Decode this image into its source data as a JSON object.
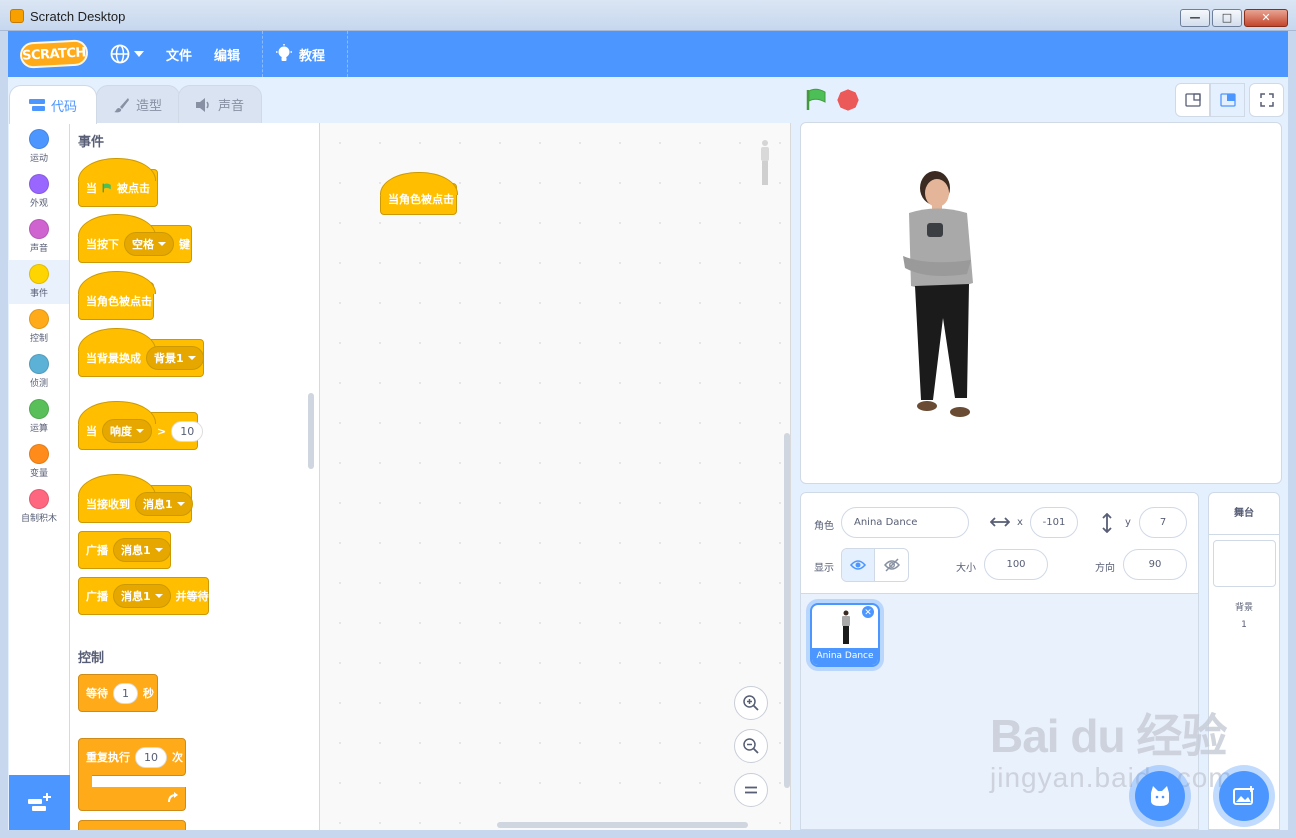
{
  "window": {
    "title": "Scratch Desktop"
  },
  "menubar": {
    "logo": "SCRATCH",
    "file": "文件",
    "edit": "编辑",
    "tutorials": "教程"
  },
  "tabs": [
    {
      "label": "代码",
      "icon": "code-icon"
    },
    {
      "label": "造型",
      "icon": "brush-icon"
    },
    {
      "label": "声音",
      "icon": "speaker-icon"
    }
  ],
  "categories": [
    {
      "label": "运动",
      "color": "#4c97ff"
    },
    {
      "label": "外观",
      "color": "#9966ff"
    },
    {
      "label": "声音",
      "color": "#cf63cf"
    },
    {
      "label": "事件",
      "color": "#ffd500"
    },
    {
      "label": "控制",
      "color": "#ffab19"
    },
    {
      "label": "侦测",
      "color": "#5cb1d6"
    },
    {
      "label": "运算",
      "color": "#59c059"
    },
    {
      "label": "变量",
      "color": "#ff8c1a"
    },
    {
      "label": "自制积木",
      "color": "#ff6680"
    }
  ],
  "palette": {
    "events_heading": "事件",
    "control_heading": "控制",
    "when_flag_pre": "当",
    "when_flag_post": "被点击",
    "when_key_pre": "当按下",
    "when_key_value": "空格",
    "when_key_post": "键",
    "when_sprite_clicked": "当角色被点击",
    "when_backdrop_pre": "当背景换成",
    "when_backdrop_value": "背景1",
    "when_loudness_pre": "当",
    "when_loudness_value": "响度",
    "when_loudness_op": ">",
    "when_loudness_num": "10",
    "when_receive_pre": "当接收到",
    "when_receive_value": "消息1",
    "broadcast_pre": "广播",
    "broadcast_value": "消息1",
    "broadcast_wait_pre": "广播",
    "broadcast_wait_value": "消息1",
    "broadcast_wait_post": "并等待",
    "wait_pre": "等待",
    "wait_num": "1",
    "wait_post": "秒",
    "repeat_pre": "重复执行",
    "repeat_num": "10",
    "repeat_post": "次"
  },
  "script": {
    "block_label": "当角色被点击"
  },
  "sprite_info": {
    "sprite_label": "角色",
    "sprite_name": "Anina Dance",
    "x_label": "x",
    "x_value": "-101",
    "y_label": "y",
    "y_value": "7",
    "show_label": "显示",
    "size_label": "大小",
    "size_value": "100",
    "direction_label": "方向",
    "direction_value": "90"
  },
  "sprite_list": [
    {
      "name": "Anina Dance"
    }
  ],
  "stage_selector": {
    "title": "舞台",
    "backdrops_label": "背景",
    "backdrops_count": "1"
  },
  "watermark": {
    "main": "Bai du 经验",
    "sub": "jingyan.baidu.com"
  },
  "colors": {
    "accent": "#4c97ff",
    "events": "#ffbf00",
    "control": "#ffab19"
  }
}
